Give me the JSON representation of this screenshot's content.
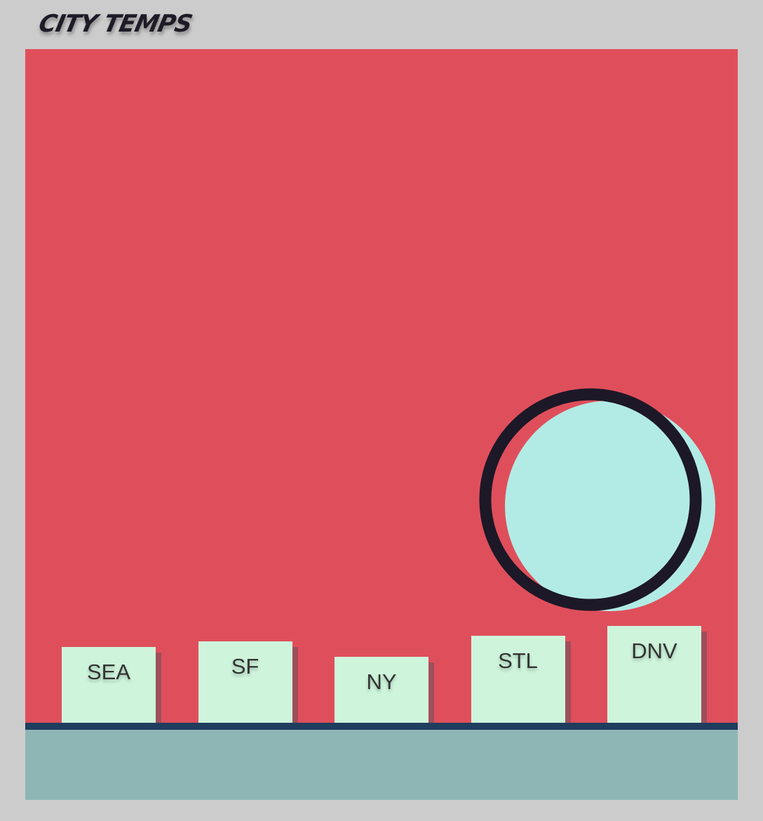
{
  "title": "CITY TEMPS",
  "colors": {
    "page_bg": "#cccccc",
    "plot_bg": "#df4f5b",
    "bar": "#cef5dc",
    "ground": "#8db6b5",
    "ground_line": "#1f3d5e",
    "circle_fill": "#b2ebe5",
    "circle_ring": "#1c1827",
    "title": "#1e1b26"
  },
  "icons": {
    "indicator": "ring-circle-icon"
  },
  "chart_data": {
    "type": "bar",
    "categories": [
      "SEA",
      "SF",
      "NY",
      "STL",
      "DNV"
    ],
    "values": [
      108,
      116,
      94,
      124,
      138
    ],
    "xlabel": "",
    "ylabel": "",
    "grid": false,
    "legend": "none"
  }
}
